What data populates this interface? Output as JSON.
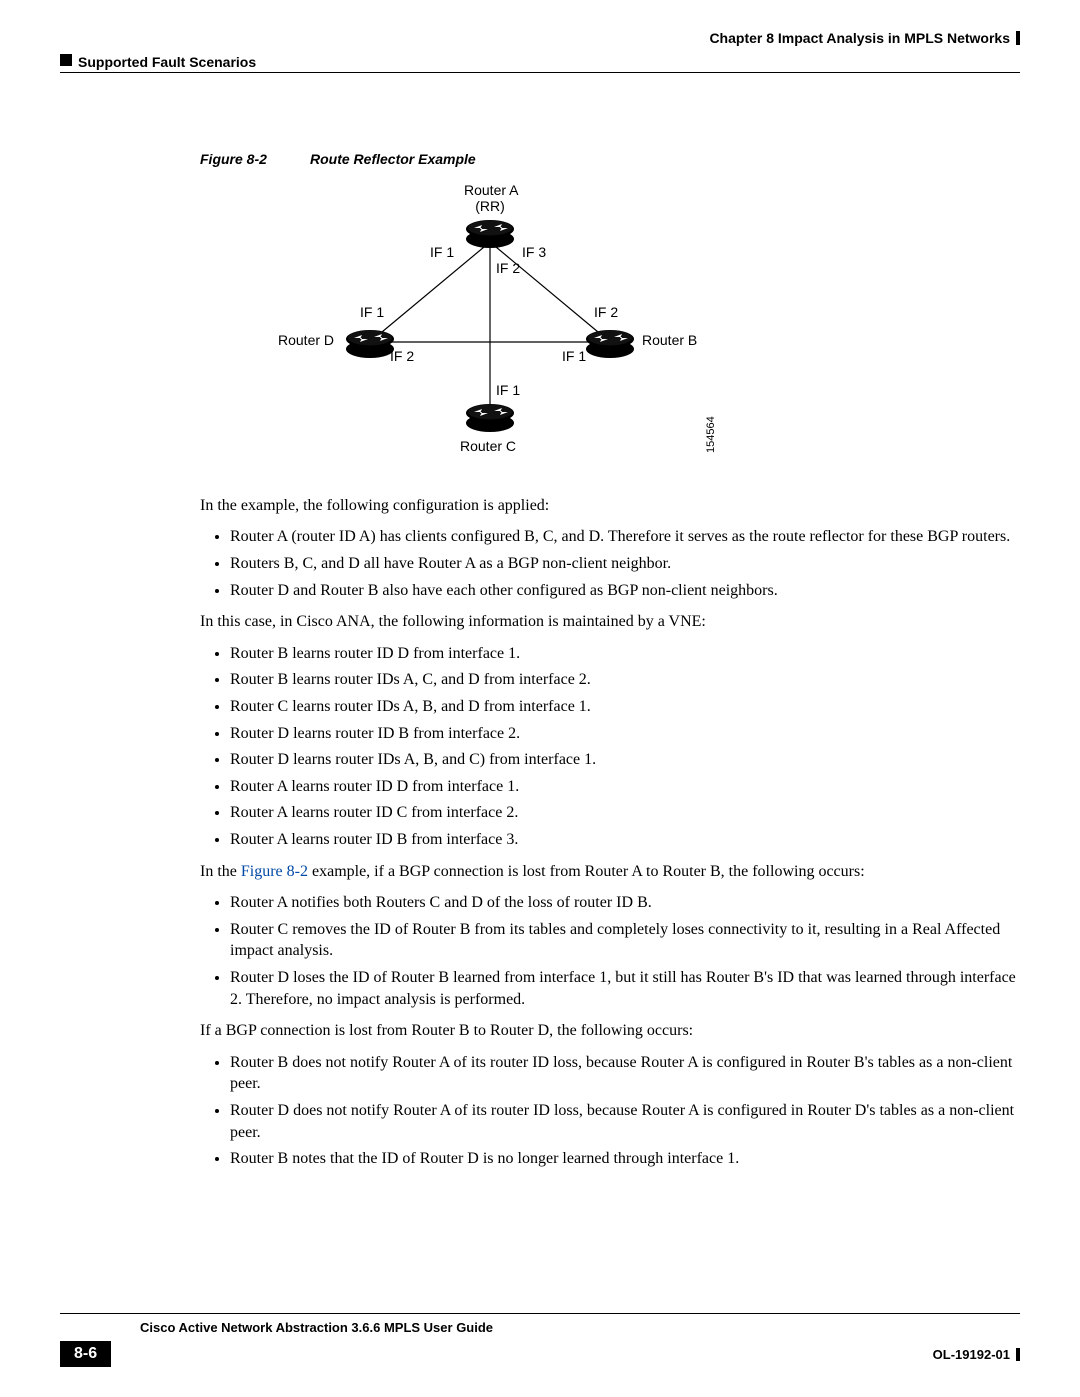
{
  "header": {
    "chapter": "Chapter 8      Impact Analysis in MPLS Networks",
    "section": "Supported Fault Scenarios"
  },
  "figure": {
    "num": "Figure 8-2",
    "title": "Route Reflector Example",
    "labels": {
      "ra1": "Router A",
      "ra2": "(RR)",
      "rb": "Router B",
      "rc": "Router C",
      "rd": "Router D",
      "a_if1": "IF 1",
      "a_if2": "IF 2",
      "a_if3": "IF 3",
      "d_if1": "IF 1",
      "d_if2": "IF 2",
      "b_if1": "IF 1",
      "b_if2": "IF 2",
      "c_if1": "IF 1",
      "id": "154564"
    }
  },
  "body": {
    "p1": "In the example, the following configuration is applied:",
    "l1": [
      "Router A (router ID A) has clients configured B, C, and D. Therefore it serves as the route reflector for these BGP routers.",
      "Routers B, C, and D all have Router A as a BGP non-client neighbor.",
      "Router D and Router B also have each other configured as BGP non-client neighbors."
    ],
    "p2": "In this case, in Cisco ANA, the following information is maintained by a VNE:",
    "l2": [
      "Router B learns router ID D from interface 1.",
      "Router B learns router IDs A, C, and D from interface 2.",
      "Router C learns router IDs A, B, and D from interface 1.",
      "Router D learns router ID B from interface 2.",
      "Router D learns router IDs A, B, and C) from interface 1.",
      "Router A learns router ID D from interface 1.",
      "Router A learns router ID C from interface 2.",
      "Router A learns router ID B from interface 3."
    ],
    "p3a": "In the ",
    "p3link": "Figure 8-2",
    "p3b": " example, if a BGP connection is lost from Router A to Router B, the following occurs:",
    "l3": [
      "Router A notifies both Routers C and D of the loss of router ID B.",
      "Router C removes the ID of Router B from its tables and completely loses connectivity to it, resulting in a Real Affected impact analysis.",
      "Router D loses the ID of Router B learned from interface 1, but it still has Router B's ID that was learned through interface 2. Therefore, no impact analysis is performed."
    ],
    "p4": "If a BGP connection is lost from Router B to Router D, the following occurs:",
    "l4": [
      "Router B does not notify Router A of its router ID loss, because Router A is configured in Router B's tables as a non-client peer.",
      "Router D does not notify Router A of its router ID loss, because Router A is configured in Router D's tables as a non-client peer.",
      "Router B notes that the ID of Router D is no longer learned through interface 1."
    ]
  },
  "footer": {
    "title": "Cisco Active Network Abstraction 3.6.6 MPLS User Guide",
    "page": "8-6",
    "docid": "OL-19192-01"
  }
}
